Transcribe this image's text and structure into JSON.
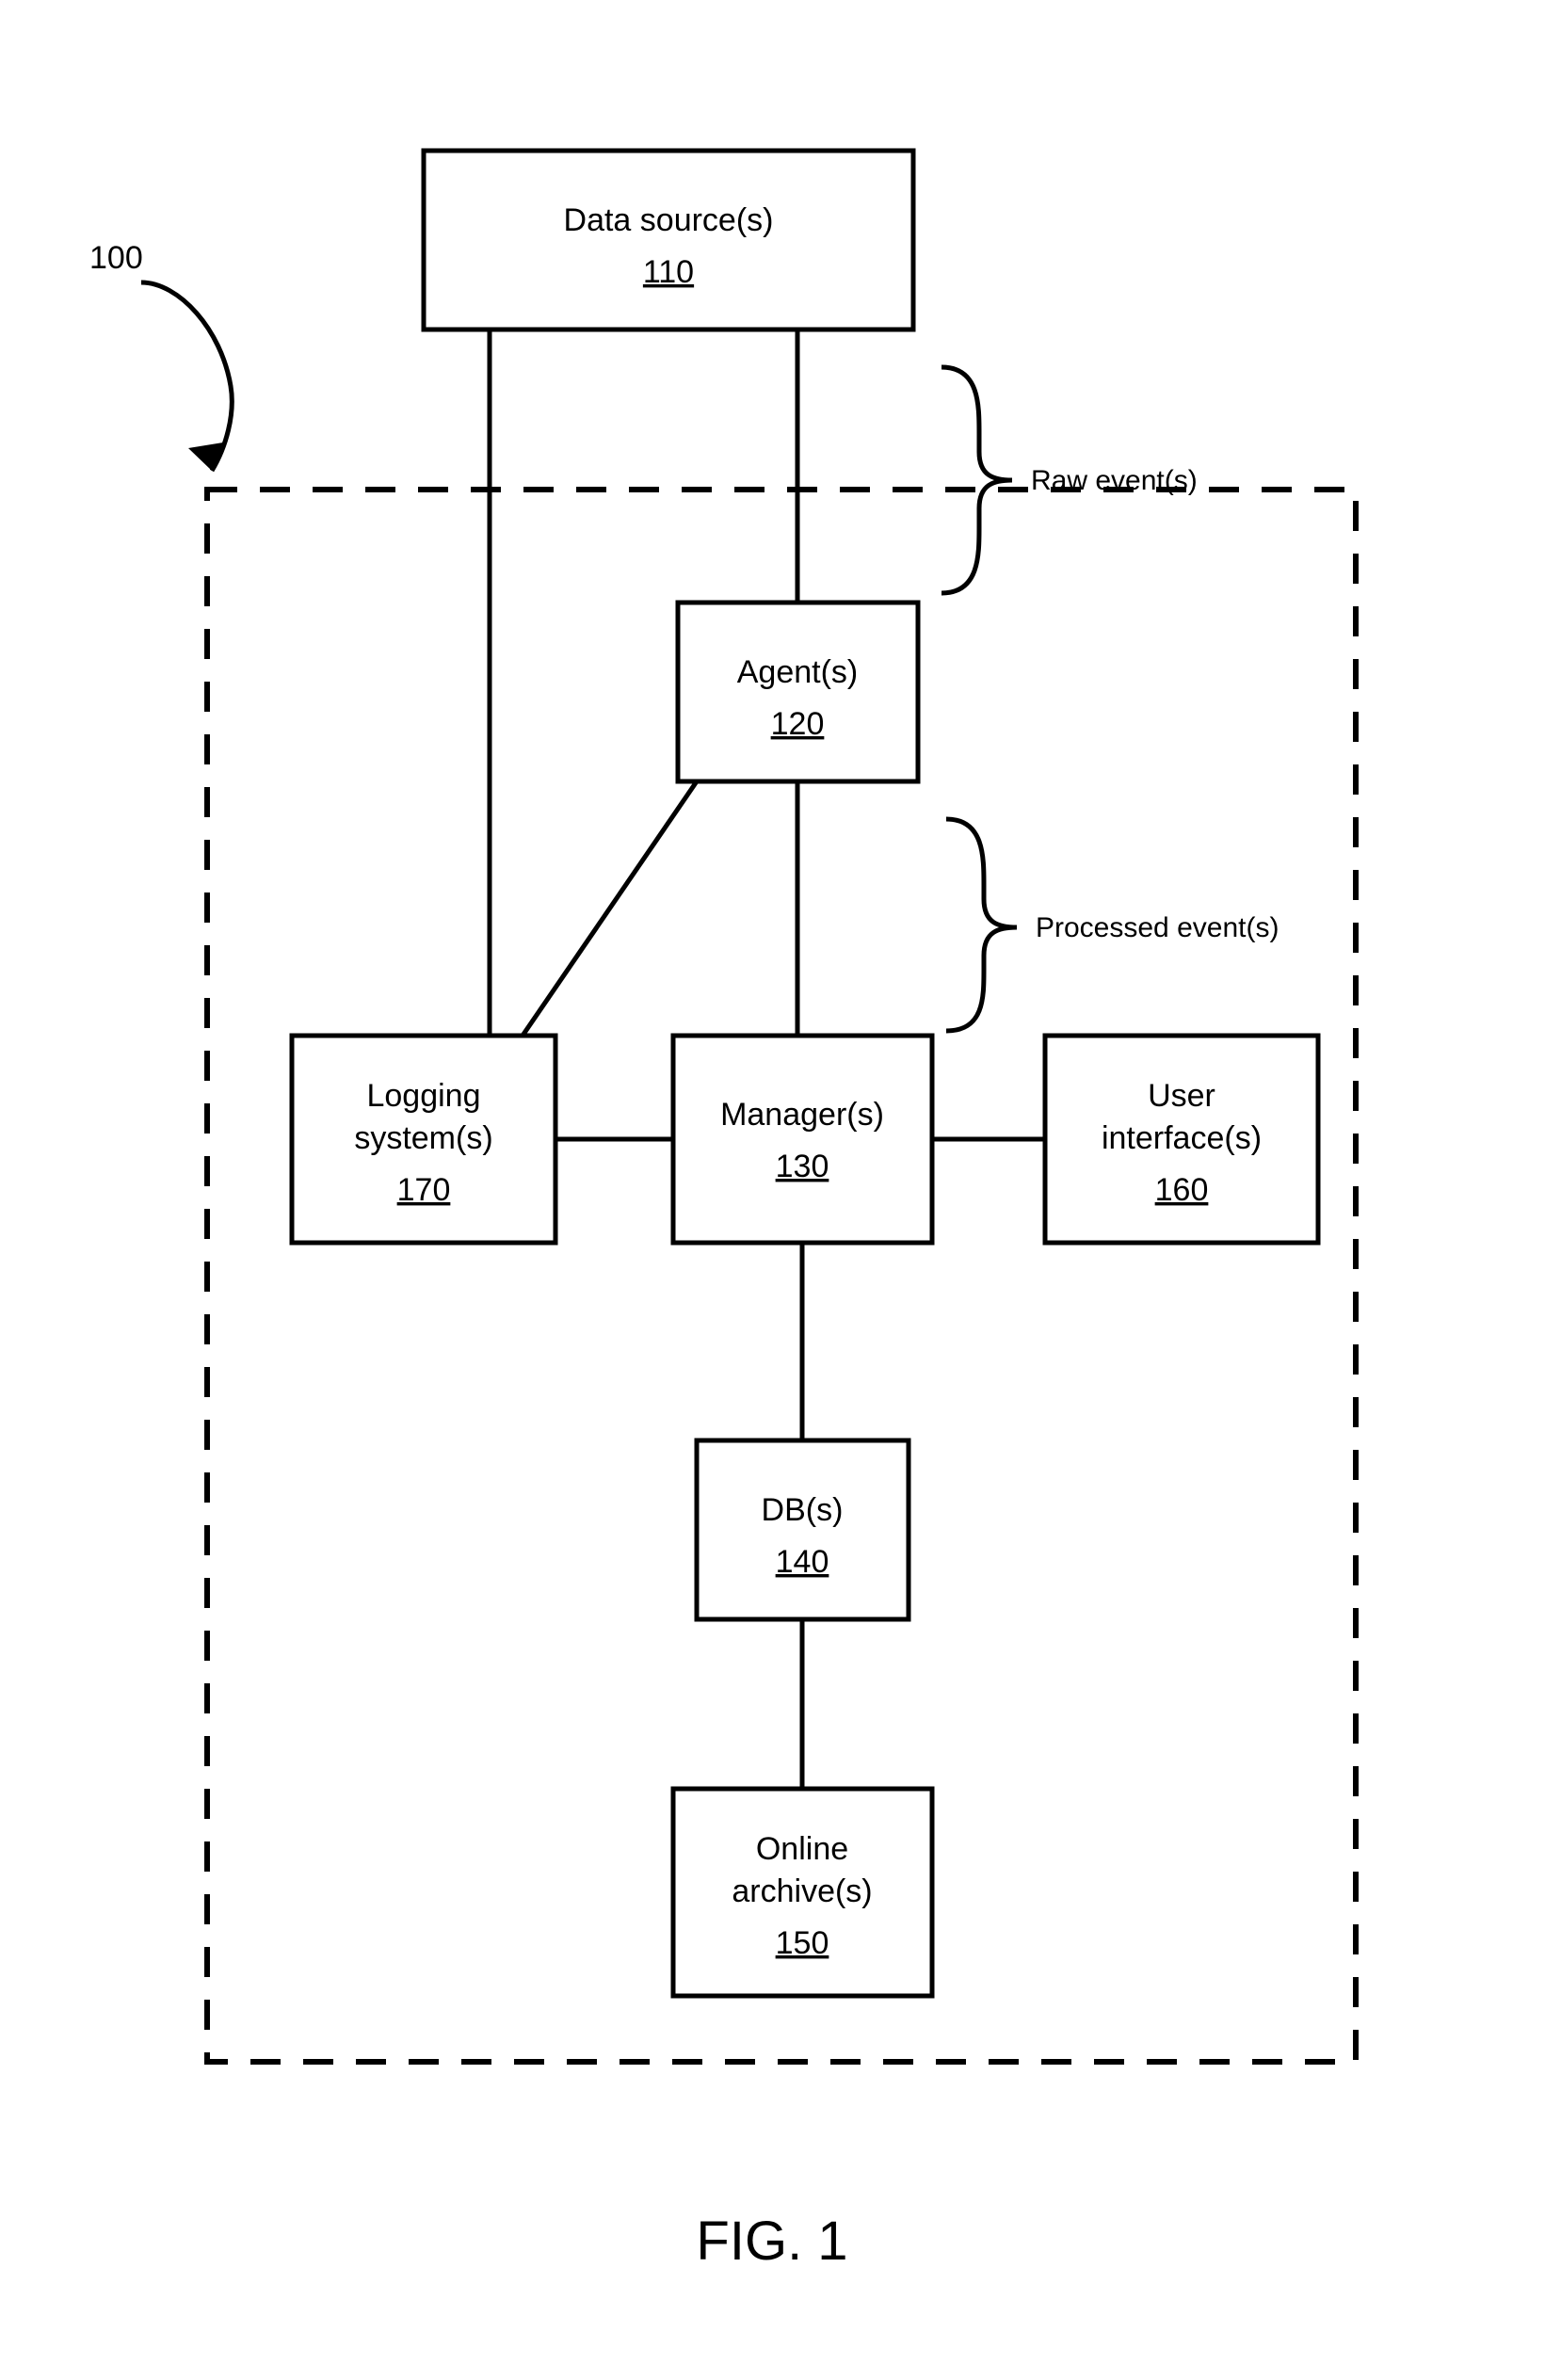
{
  "figure_label": "FIG. 1",
  "system_ref": "100",
  "boxes": {
    "data_sources": {
      "label": "Data source(s)",
      "ref": "110"
    },
    "agents": {
      "label": "Agent(s)",
      "ref": "120"
    },
    "managers": {
      "label": "Manager(s)",
      "ref": "130"
    },
    "dbs": {
      "label": "DB(s)",
      "ref": "140"
    },
    "archives_l1": "Online",
    "archives_l2": "archive(s)",
    "archives_ref": "150",
    "ui_l1": "User",
    "ui_l2": "interface(s)",
    "ui_ref": "160",
    "logging_l1": "Logging",
    "logging_l2": "system(s)",
    "logging_ref": "170"
  },
  "annotations": {
    "raw_events": "Raw event(s)",
    "processed_events": "Processed event(s)"
  }
}
